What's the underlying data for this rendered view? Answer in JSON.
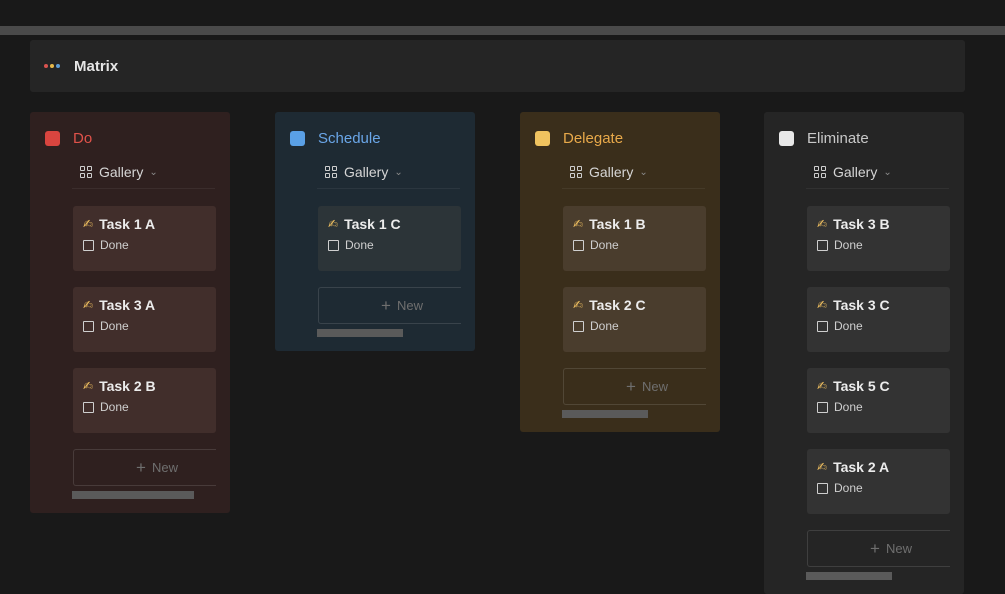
{
  "header": {
    "title": "Matrix",
    "dot_colors": [
      "#d9534f",
      "#e6b84a",
      "#5b9bd5"
    ]
  },
  "view": {
    "label": "Gallery"
  },
  "columns": [
    {
      "name": "Do",
      "swatch": "#d9453f",
      "title_color": "#e0524a",
      "bg": "#2f201f",
      "card_bg": "#412e2b",
      "cards": [
        {
          "title": "Task 1 A",
          "done_label": "Done"
        },
        {
          "title": "Task 3 A",
          "done_label": "Done"
        },
        {
          "title": "Task 2 B",
          "done_label": "Done"
        }
      ],
      "new_label": "New",
      "scroll_fraction": 0.85
    },
    {
      "name": "Schedule",
      "swatch": "#5aa0e6",
      "title_color": "#6aa6e8",
      "bg": "#1e2a33",
      "card_bg": "#2c3438",
      "cards": [
        {
          "title": "Task 1 C",
          "done_label": "Done"
        }
      ],
      "new_label": "New",
      "scroll_fraction": 0.6
    },
    {
      "name": "Delegate",
      "swatch": "#f0c35f",
      "title_color": "#e8a94a",
      "bg": "#3a2e1b",
      "card_bg": "#4a3d2d",
      "cards": [
        {
          "title": "Task 1 B",
          "done_label": "Done"
        },
        {
          "title": "Task 2 C",
          "done_label": "Done"
        }
      ],
      "new_label": "New",
      "scroll_fraction": 0.6
    },
    {
      "name": "Eliminate",
      "swatch": "#e8e8e8",
      "title_color": "#c8c8c8",
      "bg": "#252525",
      "card_bg": "#333333",
      "cards": [
        {
          "title": "Task 3 B",
          "done_label": "Done"
        },
        {
          "title": "Task 3 C",
          "done_label": "Done"
        },
        {
          "title": "Task 5 C",
          "done_label": "Done"
        },
        {
          "title": "Task 2 A",
          "done_label": "Done"
        }
      ],
      "new_label": "New",
      "scroll_fraction": 0.6
    }
  ]
}
